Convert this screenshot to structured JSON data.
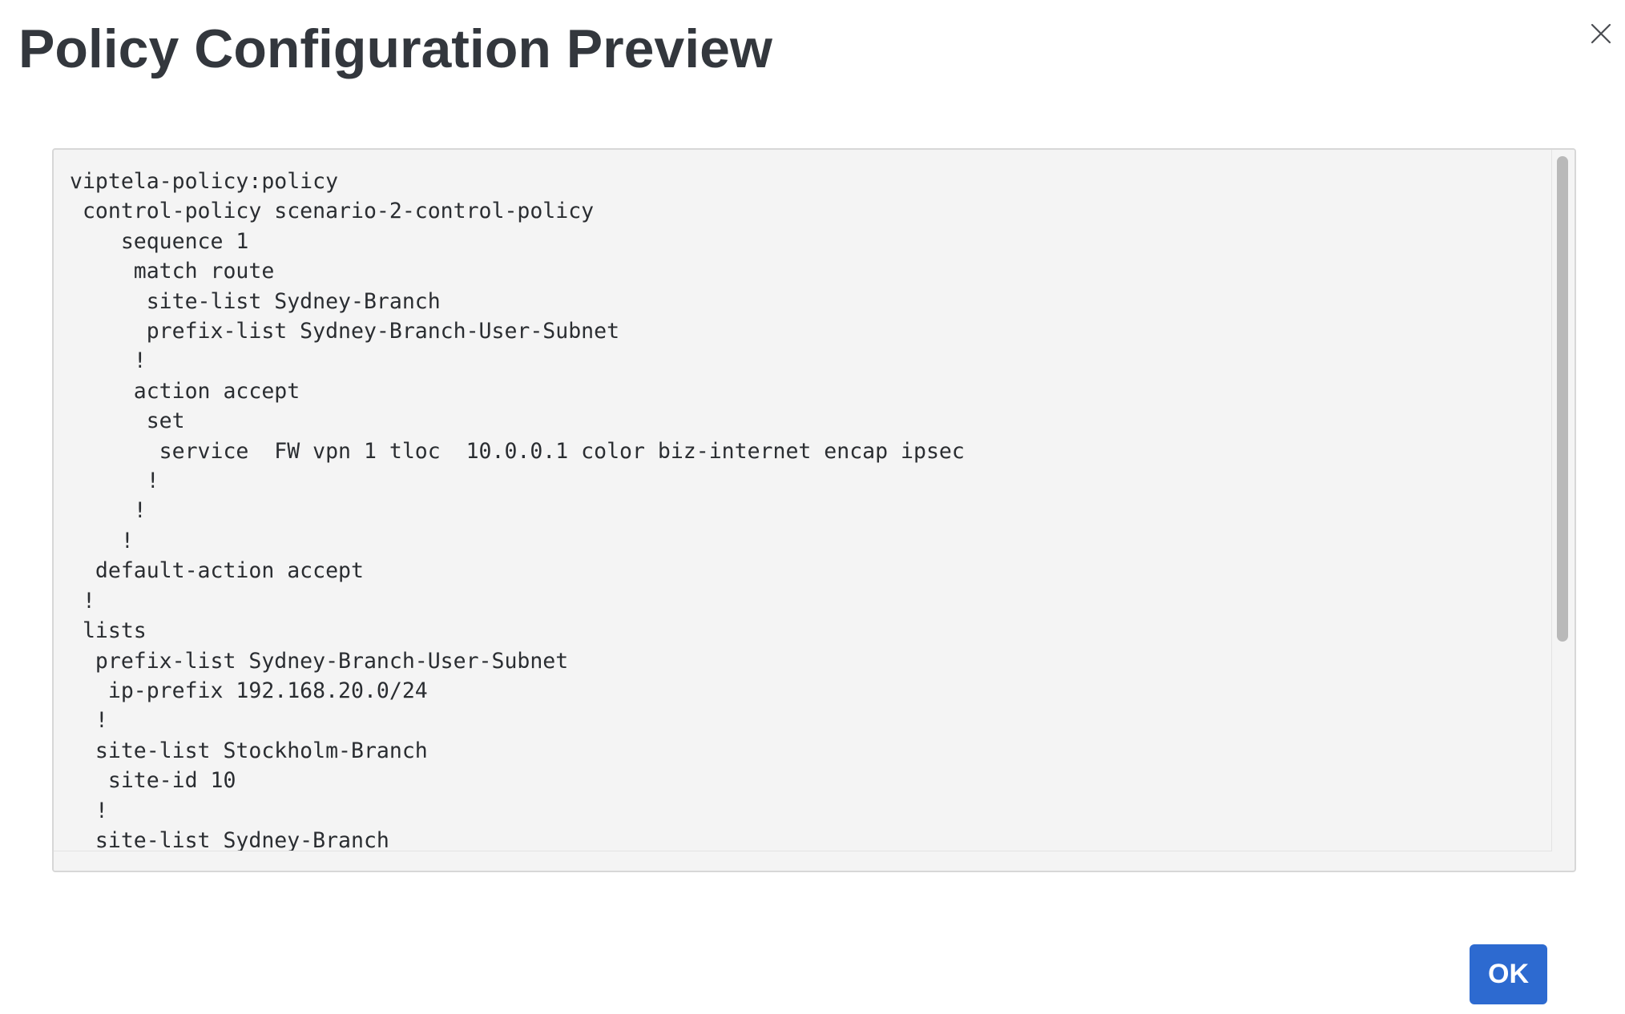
{
  "dialog": {
    "title": "Policy Configuration Preview",
    "close_icon": "close-icon",
    "ok_label": "OK",
    "accent_color": "#2d6ad0"
  },
  "config_preview": {
    "lines": [
      "viptela-policy:policy",
      " control-policy scenario-2-control-policy",
      "    sequence 1",
      "     match route",
      "      site-list Sydney-Branch",
      "      prefix-list Sydney-Branch-User-Subnet",
      "     !",
      "     action accept",
      "      set",
      "       service  FW vpn 1 tloc  10.0.0.1 color biz-internet encap ipsec",
      "      !",
      "     !",
      "    !",
      "  default-action accept",
      " !",
      " lists",
      "  prefix-list Sydney-Branch-User-Subnet",
      "   ip-prefix 192.168.20.0/24",
      "  !",
      "  site-list Stockholm-Branch",
      "   site-id 10",
      "  !",
      "  site-list Sydney-Branch"
    ]
  }
}
